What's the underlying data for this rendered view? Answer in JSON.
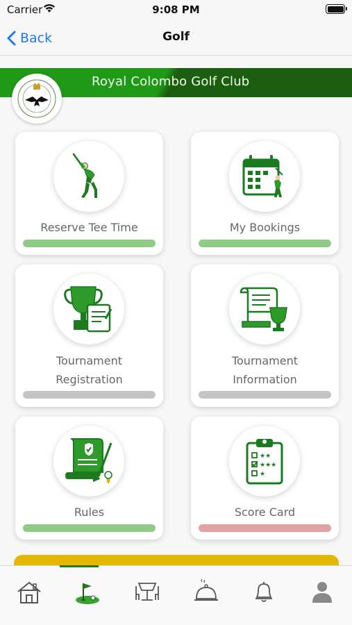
{
  "status_bar": {
    "carrier": "Carrier",
    "time": "9:08 PM"
  },
  "nav": {
    "back_label": "Back",
    "title": "Golf"
  },
  "club": {
    "name": "Royal Colombo Golf Club"
  },
  "tiles": [
    {
      "label_lines": [
        "Reserve Tee Time"
      ],
      "icon": "golfer-swing-icon",
      "bar_color": "green"
    },
    {
      "label_lines": [
        "My Bookings"
      ],
      "icon": "calendar-golfer-icon",
      "bar_color": "green"
    },
    {
      "label_lines": [
        "Tournament",
        "Registration"
      ],
      "icon": "trophy-form-icon",
      "bar_color": "grey"
    },
    {
      "label_lines": [
        "Tournament",
        "Information"
      ],
      "icon": "scroll-trophy-icon",
      "bar_color": "grey"
    },
    {
      "label_lines": [
        "Rules"
      ],
      "icon": "scroll-golf-club-icon",
      "bar_color": "green"
    },
    {
      "label_lines": [
        "Score Card"
      ],
      "icon": "clipboard-stars-icon",
      "bar_color": "red"
    }
  ],
  "tab_bar": {
    "items": [
      "home-icon",
      "golf-flag-icon",
      "dining-icon",
      "room-service-icon",
      "bell-icon",
      "user-icon"
    ],
    "active_index": 1
  },
  "colors": {
    "accent": "#1f7a17",
    "ios_blue": "#1a7cf3",
    "banner_green": "#1f9a17",
    "banner_dark": "#1b5e10",
    "highlight_yellow": "#e5b800"
  }
}
